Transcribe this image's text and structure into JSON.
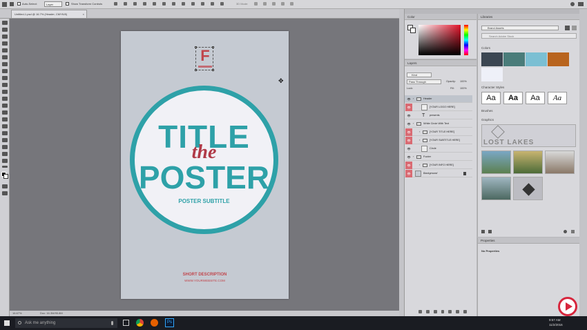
{
  "options_bar": {
    "auto_select_label": "Auto-Select:",
    "auto_select_value": "Layer",
    "transform_label": "Show Transform Controls",
    "mode_3d": "3D Mode:"
  },
  "document_tab": {
    "title": "Untitled-1.psd @ 16.7% (Header, CMYK/8)"
  },
  "status_bar": {
    "zoom": "16.67%",
    "doc_size": "Doc: 16.3M/95.8M"
  },
  "poster": {
    "title": "TITLE",
    "the": "the",
    "poster": "POSTER",
    "subtitle": "POSTER SUBTITLE",
    "short_description": "SHORT DESCRIPTION",
    "website": "WWW.YOURWEBSITE.COM",
    "logo_letter": "F"
  },
  "colors": {
    "poster_bg": "#c5cad2",
    "teal": "#2ea1a8",
    "red_accent": "#c1454b",
    "layer_highlight": "#d96a72"
  },
  "color_panel": {
    "title": "Color"
  },
  "layers_panel": {
    "title": "Layers",
    "kind_label": "Kind",
    "blend_mode": "Pass Through",
    "opacity_label": "Opacity:",
    "opacity_value": "100%",
    "lock_label": "Lock:",
    "fill_label": "Fill:",
    "fill_value": "100%",
    "layers": [
      {
        "name": "Header",
        "type": "group",
        "visible": true,
        "selected": true,
        "indent": 0
      },
      {
        "name": "[YOUR LOGO HERE]",
        "type": "smart",
        "visible": true,
        "highlight": true,
        "indent": 1
      },
      {
        "name": "presents",
        "type": "text",
        "visible": true,
        "indent": 1
      },
      {
        "name": "White Circle With Text",
        "type": "group",
        "visible": true,
        "indent": 0
      },
      {
        "name": "[YOUR TITLE HERE]",
        "type": "group",
        "visible": true,
        "highlight": true,
        "indent": 1
      },
      {
        "name": "[YOUR SUBTITLE HERE]",
        "type": "group",
        "visible": true,
        "highlight": true,
        "indent": 1
      },
      {
        "name": "Circle",
        "type": "shape",
        "visible": true,
        "indent": 1
      },
      {
        "name": "Footer",
        "type": "group",
        "visible": true,
        "indent": 0
      },
      {
        "name": "[YOUR INFO HERE]",
        "type": "group",
        "visible": true,
        "highlight": true,
        "indent": 1
      },
      {
        "name": "Background",
        "type": "bg",
        "visible": true,
        "highlight": true,
        "indent": 0,
        "locked": true
      }
    ]
  },
  "libraries_panel": {
    "title": "Libraries",
    "library_name": "Brand Assets",
    "search_placeholder": "Search Adobe Stock",
    "colors_section": "Colors",
    "swatches": [
      "#3b4652",
      "#4a7c7a",
      "#7bbfd3",
      "#b8641e",
      "#eef0f8"
    ],
    "char_styles_section": "Character Styles",
    "char_styles": [
      "Aa",
      "Aa",
      "Aa",
      "Aa"
    ],
    "brushes_section": "Brushes",
    "graphics_section": "Graphics",
    "graphic_text": "LOST LAKES"
  },
  "properties_panel": {
    "title": "Properties",
    "empty_text": "No Properties"
  },
  "taskbar": {
    "search_placeholder": "Ask me anything",
    "time": "9:57 AM",
    "date": "11/2/2016"
  }
}
